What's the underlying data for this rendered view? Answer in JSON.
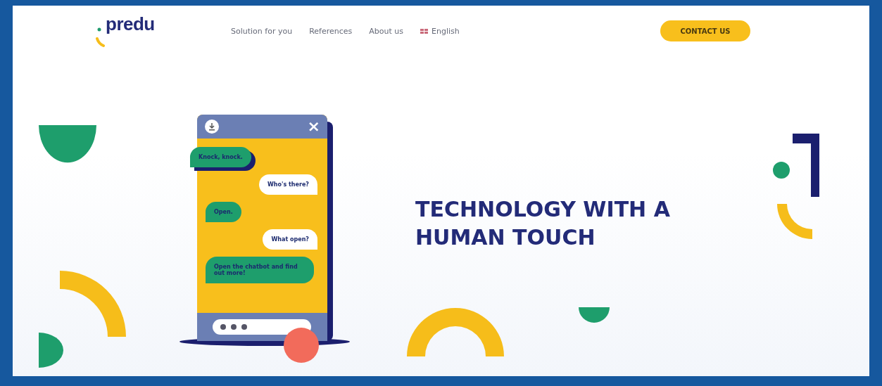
{
  "header": {
    "logo": "predu",
    "nav": [
      {
        "label": "Solution for you",
        "kind": "link"
      },
      {
        "label": "References",
        "kind": "link"
      },
      {
        "label": "About us",
        "kind": "link"
      },
      {
        "label": "English",
        "kind": "language"
      }
    ],
    "cta": "CONTACT US"
  },
  "chat": {
    "close": "×",
    "messages": [
      {
        "text": "Knock, knock.",
        "kind": "bot"
      },
      {
        "text": "Who's there?",
        "kind": "user"
      },
      {
        "text": "Open.",
        "kind": "bot"
      },
      {
        "text": "What open?",
        "kind": "user"
      },
      {
        "text": "Open the chatbot and find out more!",
        "kind": "bot"
      }
    ]
  },
  "hero": {
    "headline": "TECHNOLOGY WITH A HUMAN TOUCH"
  }
}
